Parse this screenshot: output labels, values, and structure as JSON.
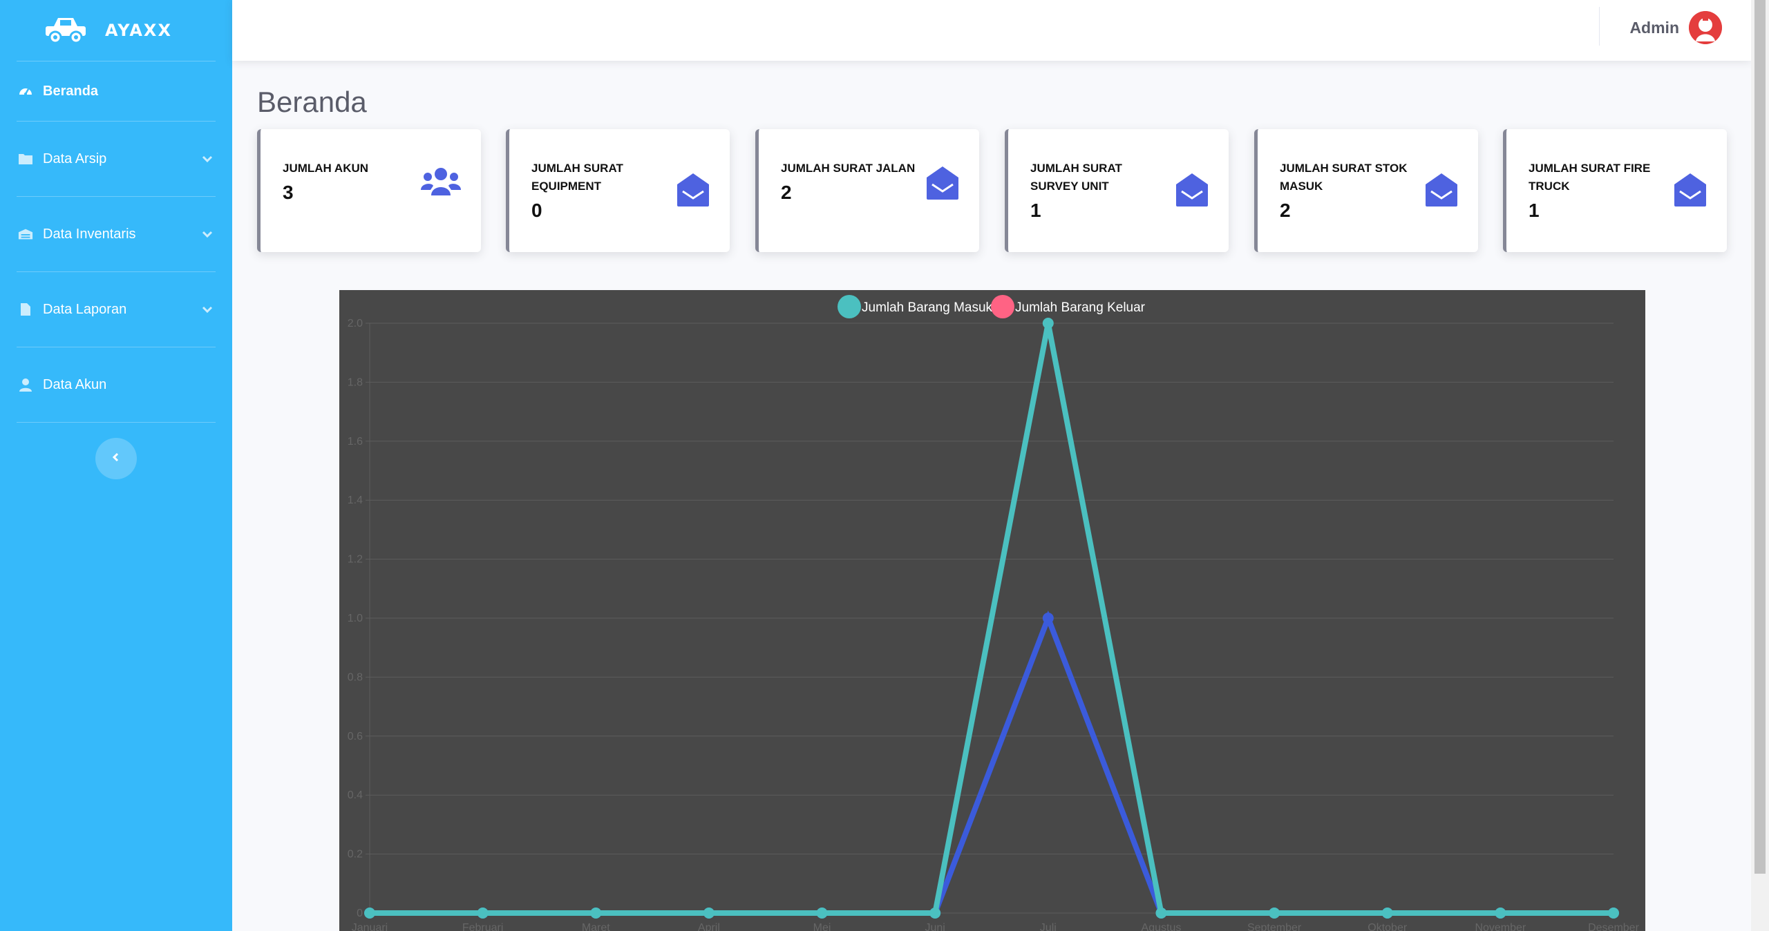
{
  "brand": {
    "name": "AYAXX"
  },
  "sidebar": {
    "items": [
      {
        "label": "Beranda",
        "icon": "tachometer-icon",
        "active": true
      },
      {
        "label": "Data Arsip",
        "icon": "folder-icon"
      },
      {
        "label": "Data Inventaris",
        "icon": "warehouse-icon"
      },
      {
        "label": "Data Laporan",
        "icon": "file-icon"
      },
      {
        "label": "Data Akun",
        "icon": "user-icon"
      }
    ]
  },
  "topbar": {
    "user_name": "Admin"
  },
  "page": {
    "title": "Beranda"
  },
  "cards": [
    {
      "label": "JUMLAH AKUN",
      "value": "3",
      "icon": "users-icon"
    },
    {
      "label": "JUMLAH SURAT EQUIPMENT",
      "value": "0",
      "icon": "envelope-open-icon"
    },
    {
      "label": "JUMLAH SURAT JALAN",
      "value": "2",
      "icon": "envelope-open-icon"
    },
    {
      "label": "JUMLAH SURAT SURVEY UNIT",
      "value": "1",
      "icon": "envelope-open-icon"
    },
    {
      "label": "JUMLAH SURAT STOK MASUK",
      "value": "2",
      "icon": "envelope-open-icon"
    },
    {
      "label": "JUMLAH SURAT FIRE TRUCK",
      "value": "1",
      "icon": "envelope-open-icon"
    }
  ],
  "colors": {
    "sidebar": "#36b9fa",
    "card_icon": "#4e62e0",
    "chart_bg": "#484848",
    "series_masuk": "#4bc0c0",
    "series_keluar_legend": "#ff6384",
    "series_keluar_line": "#3b5bdb"
  },
  "chart_data": {
    "type": "line",
    "categories": [
      "Januari",
      "Februari",
      "Maret",
      "April",
      "Mei",
      "Juni",
      "Juli",
      "Agustus",
      "September",
      "Oktober",
      "November",
      "Desember"
    ],
    "series": [
      {
        "name": "Jumlah Barang Masuk",
        "values": [
          0,
          0,
          0,
          0,
          0,
          0,
          2,
          0,
          0,
          0,
          0,
          0
        ]
      },
      {
        "name": "Jumlah  Barang Keluar",
        "values": [
          0,
          0,
          0,
          0,
          0,
          0,
          1,
          0,
          0,
          0,
          0,
          0
        ]
      }
    ],
    "y_ticks": [
      "2.0",
      "1.8",
      "1.6",
      "1.4",
      "1.2",
      "1.0",
      "0.8",
      "0.6",
      "0.4",
      "0.2",
      "0"
    ],
    "ylim": [
      0,
      2
    ],
    "grid": true,
    "legend": "top"
  }
}
